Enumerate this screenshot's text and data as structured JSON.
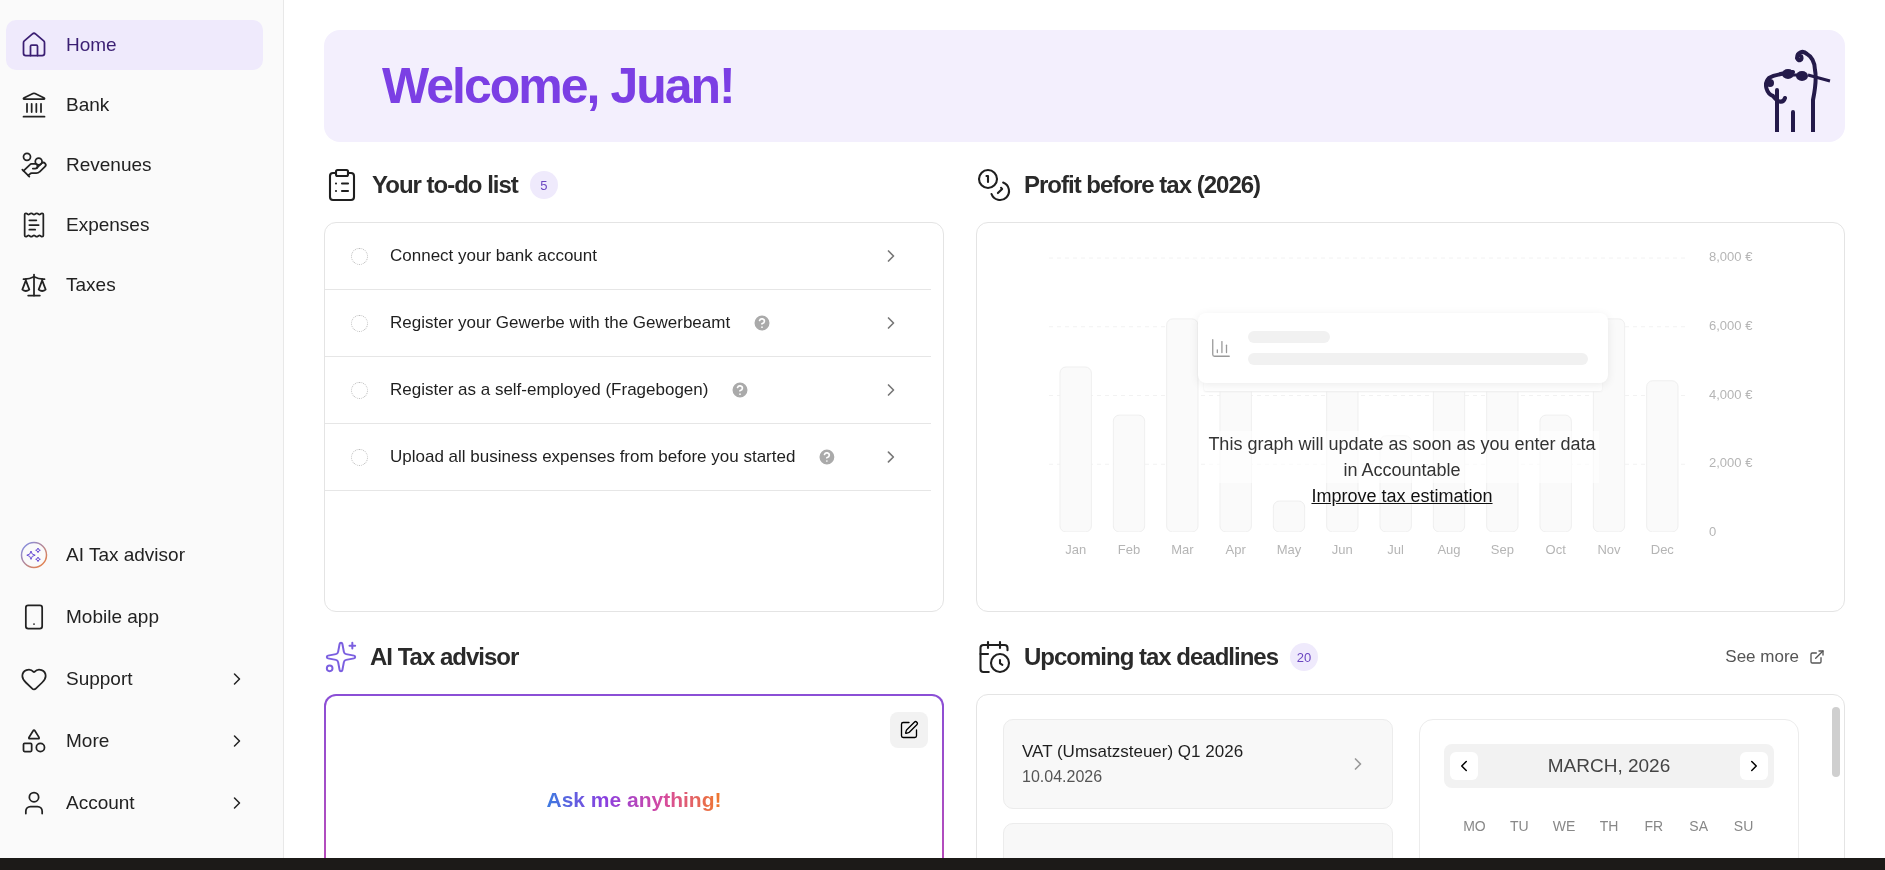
{
  "sidebar": {
    "top_items": [
      {
        "label": "Home",
        "selected": true,
        "has_submenu": false
      },
      {
        "label": "Bank",
        "selected": false,
        "has_submenu": false
      },
      {
        "label": "Revenues",
        "selected": false,
        "has_submenu": false
      },
      {
        "label": "Expenses",
        "selected": false,
        "has_submenu": false
      },
      {
        "label": "Taxes",
        "selected": false,
        "has_submenu": false
      }
    ],
    "bottom_items": [
      {
        "label": "AI Tax advisor",
        "selected": false,
        "has_submenu": false
      },
      {
        "label": "Mobile app",
        "selected": false,
        "has_submenu": false
      },
      {
        "label": "Support",
        "selected": false,
        "has_submenu": true
      },
      {
        "label": "More",
        "selected": false,
        "has_submenu": true
      },
      {
        "label": "Account",
        "selected": false,
        "has_submenu": true
      }
    ]
  },
  "banner": {
    "greeting": "Welcome, Juan!"
  },
  "todo": {
    "title": "Your to-do list",
    "count": "5",
    "tasks": [
      {
        "label": "Connect your bank account",
        "done": false,
        "has_help": false
      },
      {
        "label": "Register your Gewerbe with the Gewerbeamt",
        "done": false,
        "has_help": true
      },
      {
        "label": "Register as a self-employed (Fragebogen)",
        "done": false,
        "has_help": true
      },
      {
        "label": "Upload all business expenses from before you started",
        "done": false,
        "has_help": true
      }
    ]
  },
  "profit": {
    "title": "Profit before tax (2026)",
    "y_ticks": [
      "8,000 €",
      "6,000 €",
      "4,000 €",
      "2,000 €",
      "0"
    ],
    "months": [
      "Jan",
      "Feb",
      "Mar",
      "Apr",
      "May",
      "Jun",
      "Jul",
      "Aug",
      "Sep",
      "Oct",
      "Nov",
      "Dec"
    ],
    "empty_message": "This graph will update as soon as you enter data in Accountable",
    "link": "Improve tax estimation"
  },
  "ai_advisor": {
    "title": "AI Tax advisor",
    "prompt": "Ask me anything!"
  },
  "deadlines": {
    "title": "Upcoming tax deadlines",
    "count": "20",
    "see_more": "See more",
    "items": [
      {
        "title": "VAT (Umsatzsteuer) Q1 2026",
        "date": "10.04.2026"
      }
    ],
    "calendar": {
      "month": "MARCH, 2026",
      "weekdays": [
        "MO",
        "TU",
        "WE",
        "TH",
        "FR",
        "SA",
        "SU"
      ]
    }
  }
}
